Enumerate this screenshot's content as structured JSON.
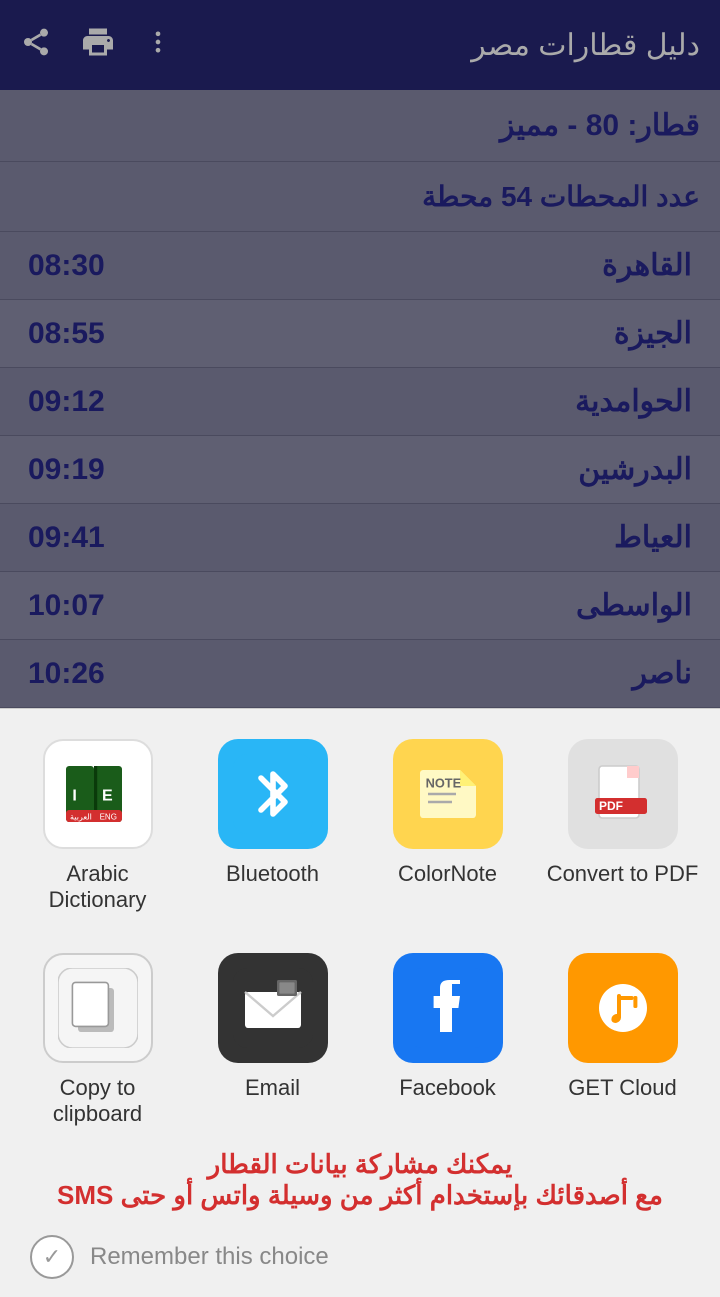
{
  "toolbar": {
    "title": "دليل قطارات مصر",
    "share_icon": "share",
    "print_icon": "print",
    "more_icon": "more_vert"
  },
  "train_info": {
    "train_label": "قطار: 80 - مميز",
    "stations_label": "عدد المحطات 54 محطة"
  },
  "schedule": [
    {
      "station": "القاهرة",
      "time": "08:30"
    },
    {
      "station": "الجيزة",
      "time": "08:55"
    },
    {
      "station": "الحوامدية",
      "time": "09:12"
    },
    {
      "station": "البدرشين",
      "time": "09:19"
    },
    {
      "station": "العياط",
      "time": "09:41"
    },
    {
      "station": "الواسطى",
      "time": "10:07"
    },
    {
      "station": "ناصر",
      "time": "10:26"
    }
  ],
  "share_apps_row1": [
    {
      "name": "Arabic Dictionary",
      "icon_type": "arabic-dict",
      "key": "arabic-dictionary"
    },
    {
      "name": "Bluetooth",
      "icon_type": "bluetooth",
      "key": "bluetooth"
    },
    {
      "name": "ColorNote",
      "icon_type": "colornote",
      "key": "colornote"
    },
    {
      "name": "Convert to PDF",
      "icon_type": "convert-pdf",
      "key": "convert-to-pdf"
    }
  ],
  "share_apps_row2": [
    {
      "name": "Copy to clipboard",
      "icon_type": "clipboard",
      "key": "copy-to-clipboard"
    },
    {
      "name": "Email",
      "icon_type": "email",
      "key": "email"
    },
    {
      "name": "Facebook",
      "icon_type": "facebook",
      "key": "facebook"
    },
    {
      "name": "GET Cloud",
      "icon_type": "getcloud",
      "key": "get-cloud"
    }
  ],
  "promo": {
    "line1": "يمكنك مشاركة بيانات القطار",
    "line2": "مع أصدقائك بإستخدام أكثر من وسيلة واتس أو حتى SMS"
  },
  "remember": {
    "label": "Remember this choice"
  }
}
